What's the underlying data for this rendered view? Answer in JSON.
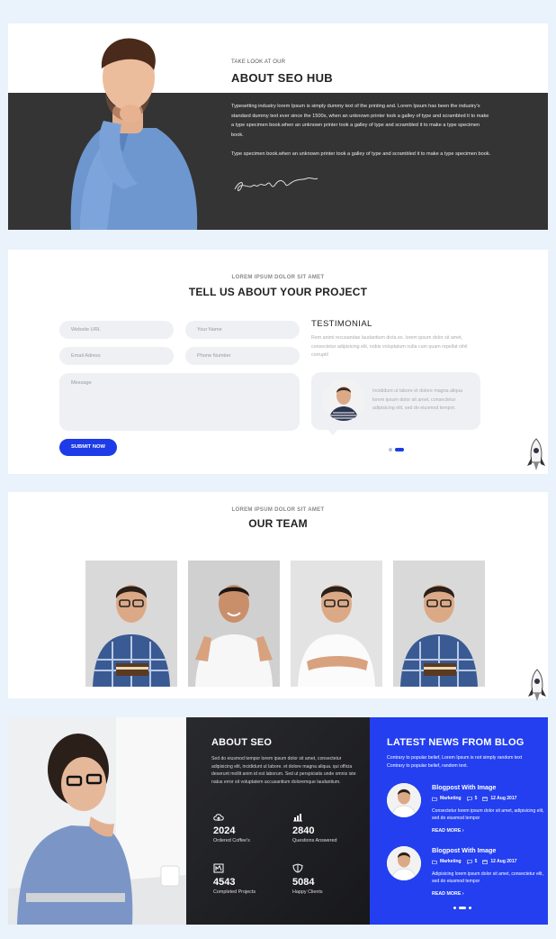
{
  "about": {
    "kicker": "TAKE LOOK AT OUR",
    "title": "ABOUT SEO HUB",
    "p1": "Typesetting industry lorem Ipsum is simply dummy text of the printing and. Lorem Ipsum has been the industry's standard dummy text ever since the 1500s, when an unknown printer took a galley of type and scrambled it to make a type specimen book.when an unknown printer took a galley of type and scrambled it to make a type specimen book.",
    "p2": "Type specimen book.when an unknown printer took a galley of type and scrambled it to make a type specimen book."
  },
  "project": {
    "kicker": "LOREM IPSUM DOLOR SIT AMET",
    "title": "TELL US ABOUT YOUR PROJECT",
    "website_placeholder": "Website URL",
    "name_placeholder": "Your Name",
    "email_placeholder": "Email Adress",
    "phone_placeholder": "Phone Number",
    "message_placeholder": "Message",
    "submit_label": "SUBMIT NOW",
    "testimonial_title": "TESTIMONIAL",
    "testimonial_intro": "Rem animi recusandae laudantium dicta es. lorem ipsum dolor sit amet, consectetur adipisicing elit, nobis voluptatum nulla cum quam repellat nihil corrupti!",
    "testimonial_quote": "Incididunt ut labore et dolore magna aliqua lorem ipsum dolor sit amet, consectetur adipisicing elit, sed do eiusmod tempor."
  },
  "team": {
    "kicker": "LOREM IPSUM DOLOR SIT AMET",
    "title": "OUR TEAM"
  },
  "seo": {
    "title": "ABOUT SEO",
    "desc": "Sed do eiusmod tempor lorem ipsum dolor sit amet, consectetur adipisicing elit, incididunt ut labore. et dolore magna aliqua. qui officia deserunt mollit anim id est laborum. Sed ut perspiciatis unde omnis iste natus error sit voluptatem accusantium doloremque laudantium.",
    "stats": [
      {
        "value": "2024",
        "label": "Ordered Coffee's",
        "icon": "cloud-upload-icon"
      },
      {
        "value": "2840",
        "label": "Questions Answered",
        "icon": "bar-chart-icon"
      },
      {
        "value": "4543",
        "label": "Completed Projects",
        "icon": "chart-icon"
      },
      {
        "value": "5084",
        "label": "Happy Clients",
        "icon": "shield-icon"
      }
    ]
  },
  "blog": {
    "title": "LATEST NEWS FROM BLOG",
    "desc": "Contrary to popular belief, Lorem Ipsum is not simply random text Contrary to popular belief, random text.",
    "posts": [
      {
        "title": "Blogpost With Image",
        "category": "Marketing",
        "comments": "5",
        "date": "12 Aug 2017",
        "excerpt": "Consectetur lorem ipsum dolor sit amet, adipisicing elit, sed do eiusmod tempor",
        "more": "READ MORE"
      },
      {
        "title": "Blogpost With Image",
        "category": "Marketing",
        "comments": "5",
        "date": "12 Aug 2017",
        "excerpt": "Adipisicing lorem ipsum dolor sit amet, consectetur elit, sed do eiusmod tempor",
        "more": "READ MORE"
      }
    ]
  },
  "colors": {
    "accent": "#233ff0",
    "dark": "#343434",
    "page_bg": "#eaf3fc"
  }
}
